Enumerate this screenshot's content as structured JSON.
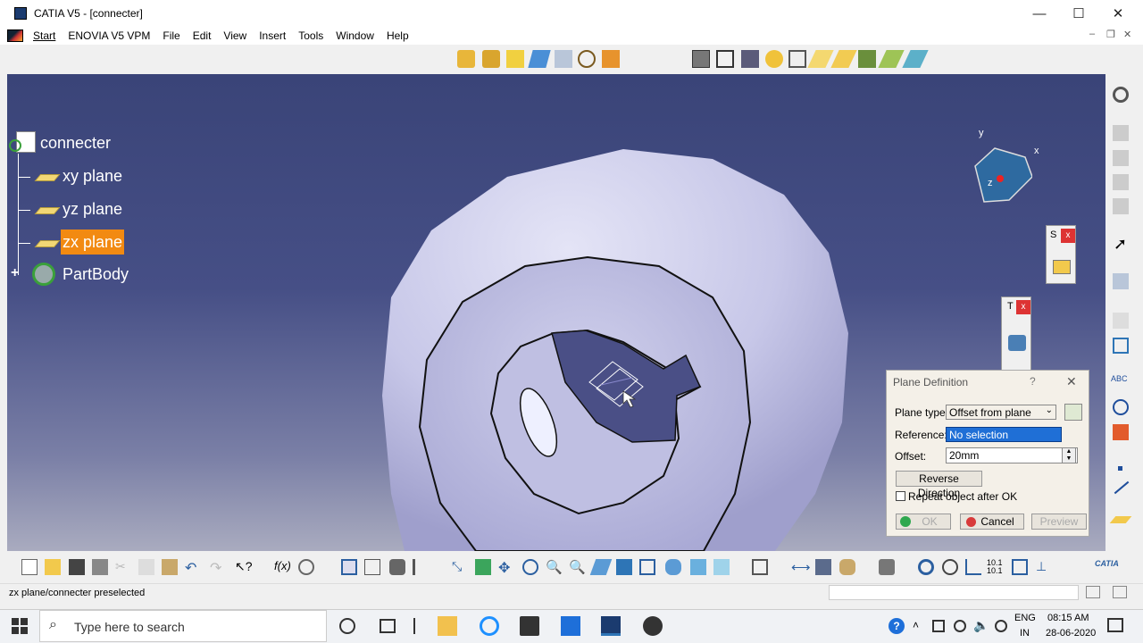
{
  "window": {
    "title": "CATIA V5 - [connecter]",
    "minimize": "—",
    "maximize": "☐",
    "close": "✕"
  },
  "menu": {
    "items": [
      "Start",
      "ENOVIA V5 VPM",
      "File",
      "Edit",
      "View",
      "Insert",
      "Tools",
      "Window",
      "Help"
    ]
  },
  "tree": {
    "root": "connecter",
    "items": [
      "xy plane",
      "yz plane",
      "zx plane",
      "PartBody"
    ],
    "selected": "zx plane"
  },
  "compass": {
    "x": "x",
    "y": "y",
    "z": "z"
  },
  "mini_toolbars": {
    "s": "S",
    "t": "T"
  },
  "dialog": {
    "title": "Plane Definition",
    "help": "?",
    "close": "✕",
    "plane_type_label": "Plane type:",
    "plane_type_value": "Offset from plane",
    "reference_label": "Reference:",
    "reference_value": "No selection",
    "offset_label": "Offset:",
    "offset_value": "20mm",
    "reverse_label": "Reverse Direction",
    "repeat_label": "Repeat object after OK",
    "ok_label": "OK",
    "cancel_label": "Cancel",
    "preview_label": "Preview"
  },
  "status": {
    "text": "zx plane/connecter preselected"
  },
  "taskbar": {
    "search_placeholder": "Type here to search",
    "lang": "ENG",
    "region": "IN",
    "time": "08:15 AM",
    "date": "28-06-2020"
  },
  "colors": {
    "selected": "#f28a12",
    "viewport_top": "#3a4478",
    "part": "#c9c9ea"
  }
}
